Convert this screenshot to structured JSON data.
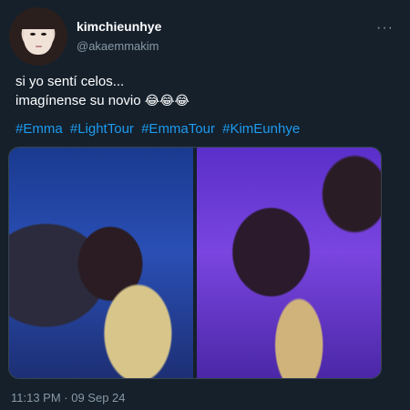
{
  "author": {
    "display_name": "kimchieunhye",
    "handle": "@akaemmakim",
    "avatar_icon": "avatar-photo"
  },
  "tweet": {
    "line1": "si yo sentí celos...",
    "line2": "imagínense su novio",
    "emoji": "😂😂😂",
    "hashtags": [
      "#Emma",
      "#LightTour",
      "#EmmaTour",
      "#KimEunhye"
    ],
    "timestamp": "11:13 PM · 09 Sep 24"
  },
  "menu": {
    "more_label": "···"
  },
  "colors": {
    "background": "#15202b",
    "text": "#ffffff",
    "secondary": "#8899a6",
    "link": "#1d9bf0"
  }
}
